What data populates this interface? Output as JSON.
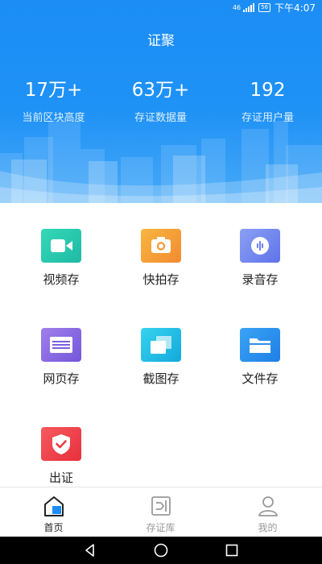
{
  "status_bar": {
    "network": "46",
    "battery": "56",
    "time": "下午4:07"
  },
  "app": {
    "title": "证聚"
  },
  "stats": [
    {
      "value": "17万+",
      "label": "当前区块高度"
    },
    {
      "value": "63万+",
      "label": "存证数据量"
    },
    {
      "value": "192",
      "label": "存证用户量"
    }
  ],
  "features": [
    {
      "label": "视频存",
      "icon": "video-camera-icon",
      "color": "#2ccfb0"
    },
    {
      "label": "快拍存",
      "icon": "camera-icon",
      "color": "#f6a03a"
    },
    {
      "label": "录音存",
      "icon": "audio-wave-icon",
      "color": "#6f86ef"
    },
    {
      "label": "网页存",
      "icon": "webpage-icon",
      "color": "#8b67e3"
    },
    {
      "label": "截图存",
      "icon": "screenshot-icon",
      "color": "#1ec3e5"
    },
    {
      "label": "文件存",
      "icon": "folder-icon",
      "color": "#2a8ef0"
    },
    {
      "label": "出证",
      "icon": "shield-check-icon",
      "color": "#f0404a"
    }
  ],
  "tabs": [
    {
      "label": "首页",
      "icon": "home-icon",
      "active": true
    },
    {
      "label": "存证库",
      "icon": "vault-icon",
      "active": false
    },
    {
      "label": "我的",
      "icon": "user-icon",
      "active": false
    }
  ],
  "colors": {
    "primary": "#1b8df5",
    "tab_active": "#222222",
    "tab_inactive": "#999999"
  }
}
